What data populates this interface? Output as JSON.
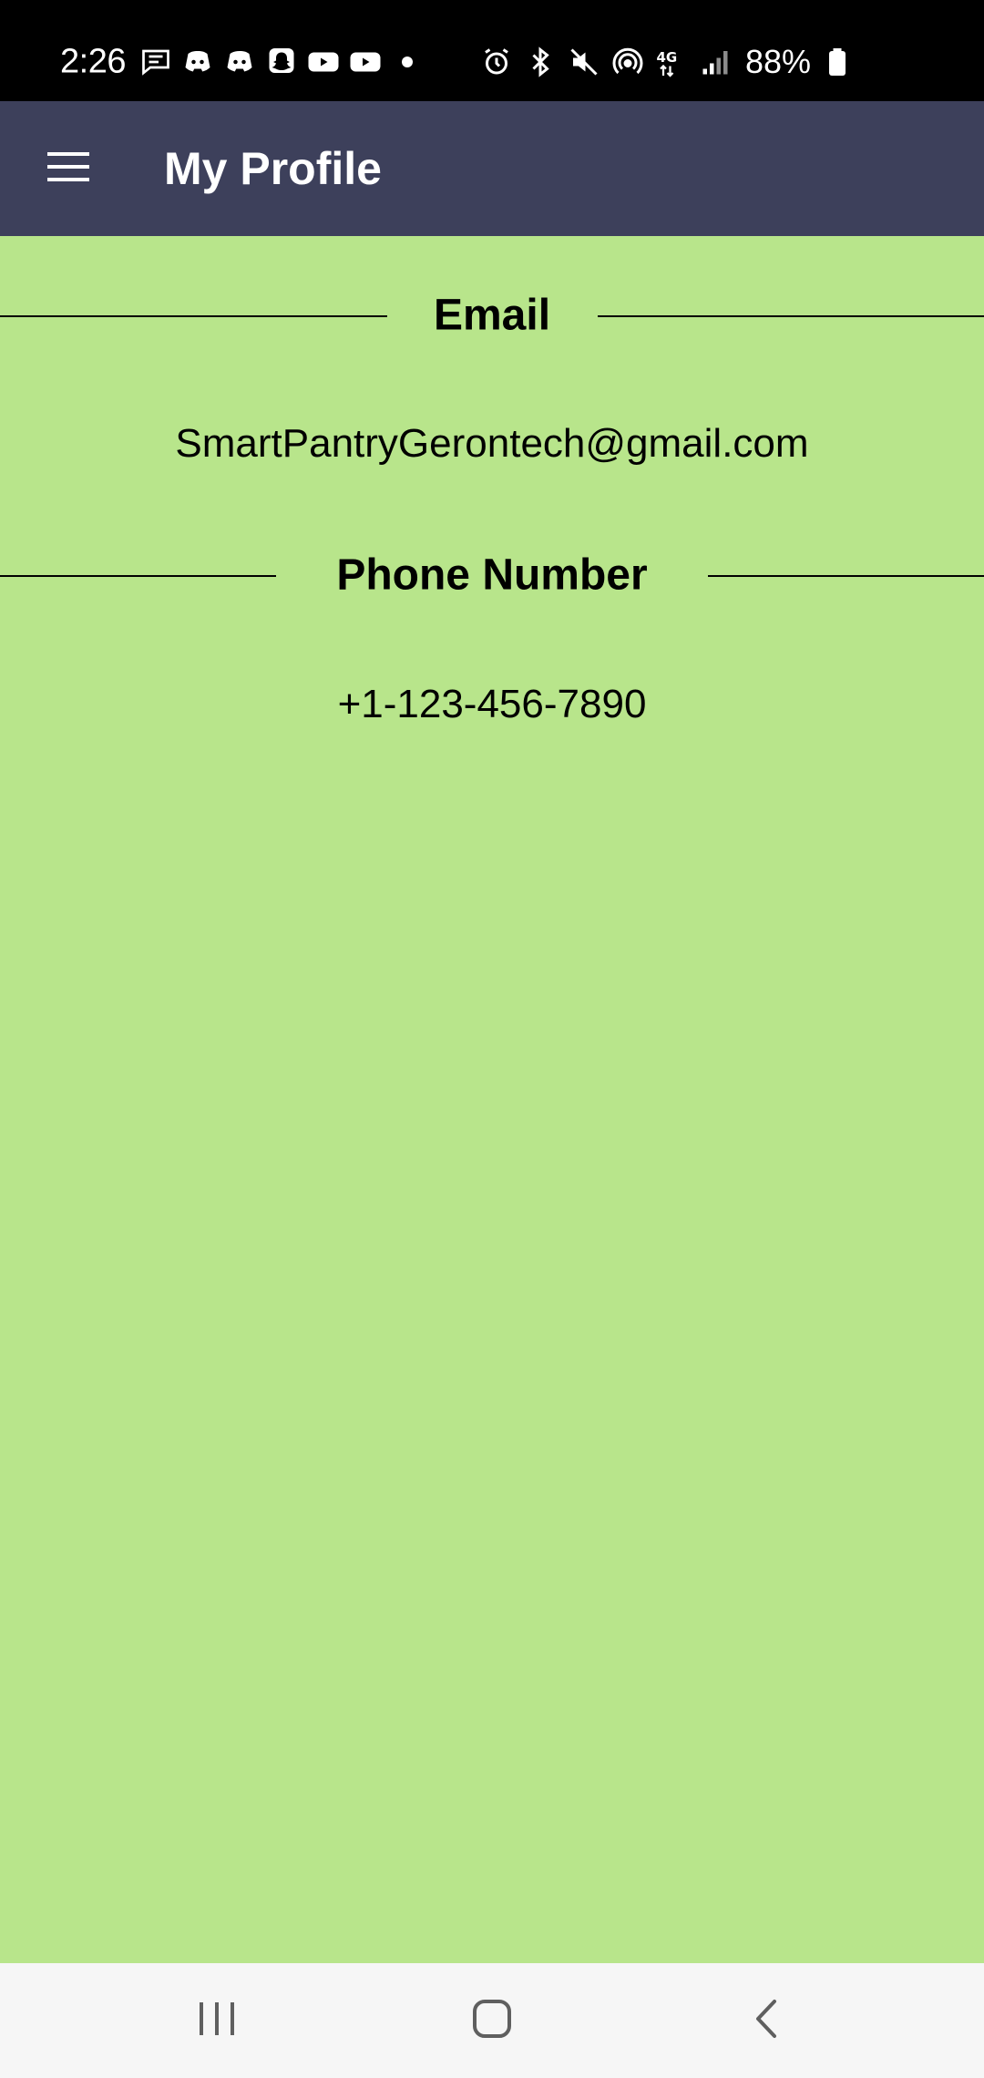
{
  "status_bar": {
    "time": "2:26",
    "battery_percent": "88%",
    "left_icons": [
      "chat-icon",
      "discord-icon",
      "discord-icon",
      "snapchat-icon",
      "youtube-icon",
      "youtube-icon",
      "dot-icon"
    ],
    "right_icons": [
      "alarm-icon",
      "bluetooth-icon",
      "mute-icon",
      "hotspot-icon",
      "4g-lte-icon",
      "signal-icon",
      "battery-icon"
    ]
  },
  "app_bar": {
    "title": "My Profile",
    "background_color": "#3d405b",
    "menu_icon": "hamburger-menu-icon"
  },
  "profile": {
    "email_header": "Email",
    "email_value": "SmartPantryGerontech@gmail.com",
    "phone_header": "Phone Number",
    "phone_value": "+1-123-456-7890",
    "background_color": "#b8e58b"
  },
  "nav_bar": {
    "buttons": [
      "recent-apps-icon",
      "home-icon",
      "back-icon"
    ]
  }
}
